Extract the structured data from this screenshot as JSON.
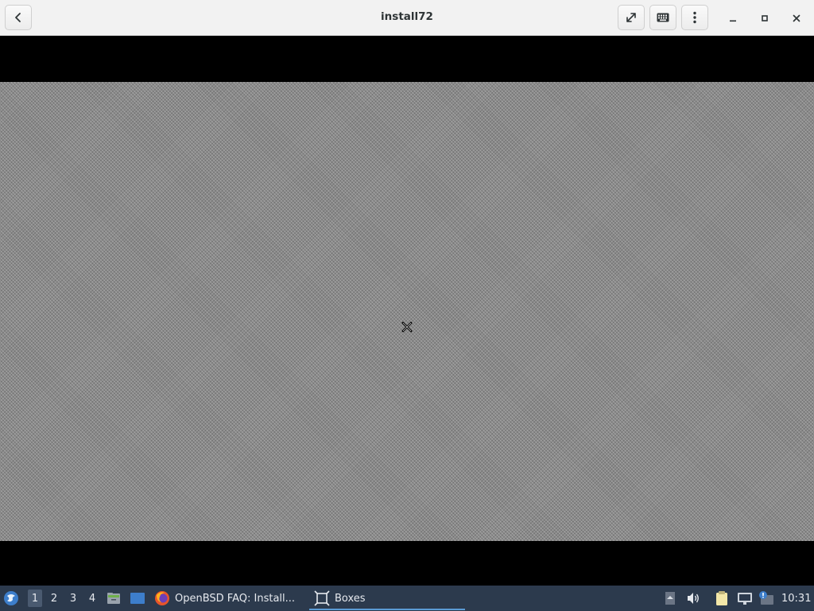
{
  "window": {
    "title": "install72",
    "buttons": {
      "back": "back-icon",
      "fullscreen": "fullscreen-icon",
      "keyboard": "keyboard-icon",
      "menu": "kebab-menu-icon",
      "minimize": "minimize-icon",
      "maximize": "maximize-icon",
      "close": "close-icon"
    }
  },
  "vm": {
    "state": "X server root window with stipple background and X cursor",
    "cursor_icon": "x-cursor-icon"
  },
  "taskbar": {
    "start_icon": "app-menu-icon",
    "workspaces": [
      "1",
      "2",
      "3",
      "4"
    ],
    "active_workspace": "1",
    "launchers": [
      "file-manager-icon",
      "show-desktop-icon"
    ],
    "tasks": [
      {
        "label": "OpenBSD FAQ: Install...",
        "icon": "firefox-icon",
        "active": false
      },
      {
        "label": "Boxes",
        "icon": "boxes-icon",
        "active": true
      }
    ],
    "tray": [
      "tray-expand-icon",
      "volume-icon",
      "clipboard-icon",
      "network-icon",
      "notification-icon"
    ],
    "clock": "10:31"
  },
  "colors": {
    "headerbar": "#f2f2f2",
    "taskbar": "#2c3a4d",
    "active_task_underline": "#5b9bd5"
  }
}
